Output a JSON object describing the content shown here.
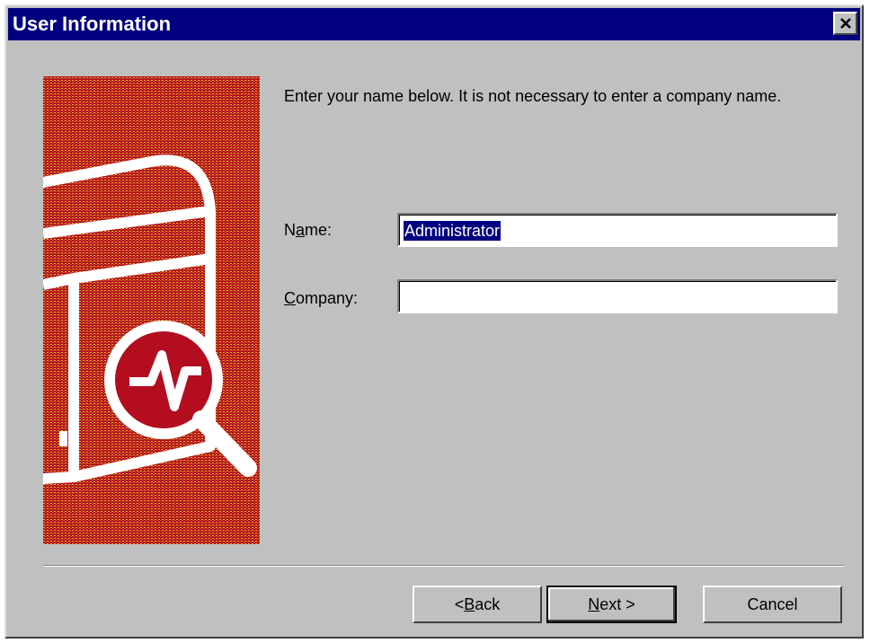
{
  "window": {
    "title": "User Information",
    "close_glyph": "✕"
  },
  "banner": {
    "icon": "server-magnifier-icon",
    "colors": {
      "red": "#b30d1f",
      "stripe": "#e7b52a"
    }
  },
  "instructions": "Enter your name below.  It is not necessary to enter a company name.",
  "fields": {
    "name": {
      "label_pre": "N",
      "label_mnemonic": "a",
      "label_post": "me:",
      "value": "Administrator"
    },
    "company": {
      "label_pre": "",
      "label_mnemonic": "C",
      "label_post": "ompany:",
      "value": ""
    }
  },
  "buttons": {
    "back": {
      "pre": "< ",
      "mnemonic": "B",
      "post": "ack"
    },
    "next": {
      "pre": "",
      "mnemonic": "N",
      "post": "ext >"
    },
    "cancel": {
      "label": "Cancel"
    }
  }
}
